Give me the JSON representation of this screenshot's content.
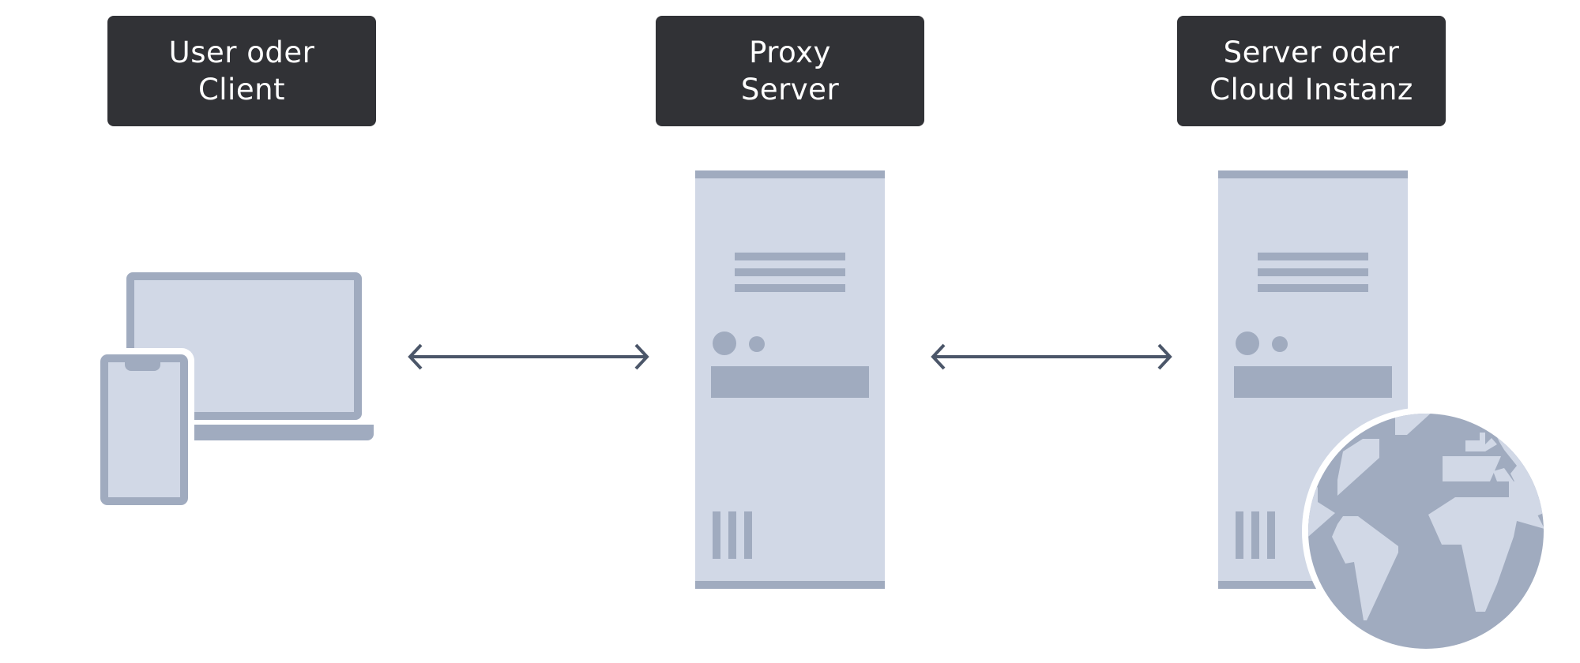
{
  "nodes": [
    {
      "id": "client",
      "label_lines": [
        "User oder",
        "Client"
      ],
      "icon": "laptop-and-phone-icon"
    },
    {
      "id": "proxy",
      "label_lines": [
        "Proxy",
        "Server"
      ],
      "icon": "server-tower-icon"
    },
    {
      "id": "server",
      "label_lines": [
        "Server oder",
        "Cloud Instanz"
      ],
      "icon": "server-tower-with-globe-icon"
    }
  ],
  "connections": [
    {
      "from": "client",
      "to": "proxy",
      "direction": "bidirectional"
    },
    {
      "from": "proxy",
      "to": "server",
      "direction": "bidirectional"
    }
  ],
  "colors": {
    "label_bg": "#313236",
    "label_text": "#ffffff",
    "icon_light": "#d1d8e6",
    "icon_dark": "#a0abbf",
    "arrow": "#4b5669"
  }
}
